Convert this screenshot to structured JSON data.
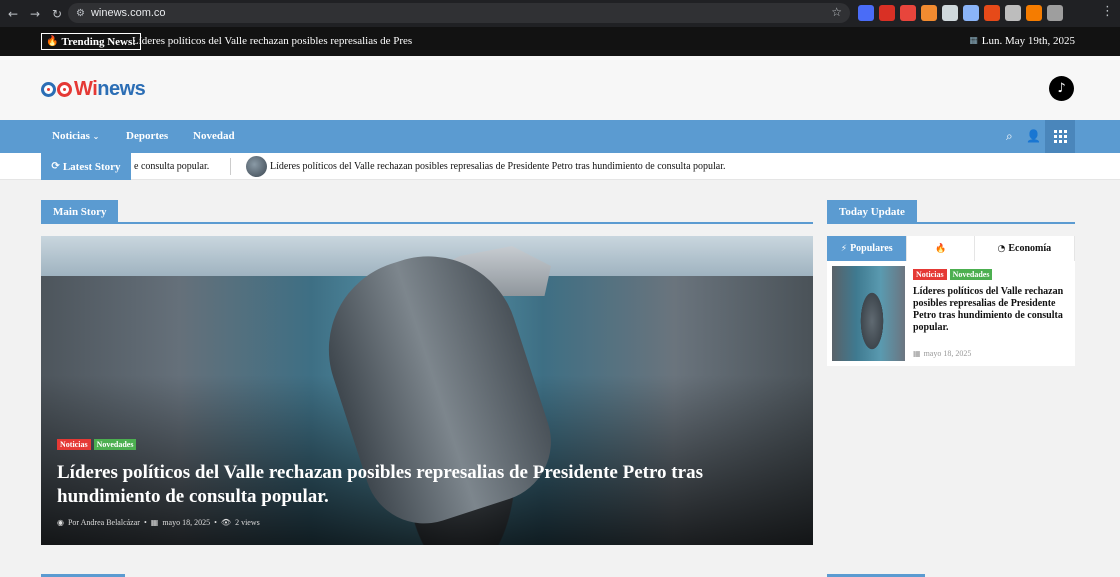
{
  "browser": {
    "url": "winews.com.co",
    "extension_colors": [
      "#4a6cf7",
      "#d93025",
      "#e8453c",
      "#f28b30",
      "#cfd8dc",
      "#8ab4f8",
      "#e64a19",
      "#bdbdbd",
      "#f57c00",
      "#9e9e9e"
    ]
  },
  "trending": {
    "label": "Trending News:",
    "headline": "Líderes políticos del Valle rechazan posibles represalias de Presidente",
    "date": "Lun. May 19th, 2025"
  },
  "brand": {
    "name_part1": "Wi",
    "name_part2": "news",
    "accent": "#5b9bd1",
    "red": "#e53935",
    "green": "#4caf50"
  },
  "nav": {
    "items": [
      "Noticias",
      "Deportes",
      "Novedad"
    ],
    "caret": "⌄"
  },
  "latest": {
    "label": "Latest Story",
    "ticker_fragment": "e consulta popular.",
    "ticker_full": "Líderes políticos del Valle rechazan posibles represalias de Presidente Petro tras hundimiento de consulta popular."
  },
  "main_story": {
    "section_title": "Main Story",
    "categories": [
      "Noticias",
      "Novedades"
    ],
    "title": "Líderes políticos del Valle rechazan posibles represalias de Presidente Petro tras hundimiento de consulta popular.",
    "author": "Por Andrea Belalcázar",
    "date": "mayo 18, 2025",
    "views": "2 views"
  },
  "today_update": {
    "section_title": "Today Update",
    "tabs": [
      {
        "label": "Populares",
        "icon": "bolt-icon"
      },
      {
        "label": "",
        "icon": "fire-icon"
      },
      {
        "label": "Economía",
        "icon": "clock-icon"
      }
    ],
    "card": {
      "categories": [
        "Noticias",
        "Novedades"
      ],
      "title": "Líderes políticos del Valle rechazan posibles represalias de Presidente Petro tras hundimiento de consulta popular.",
      "date": "mayo 18, 2025"
    }
  }
}
